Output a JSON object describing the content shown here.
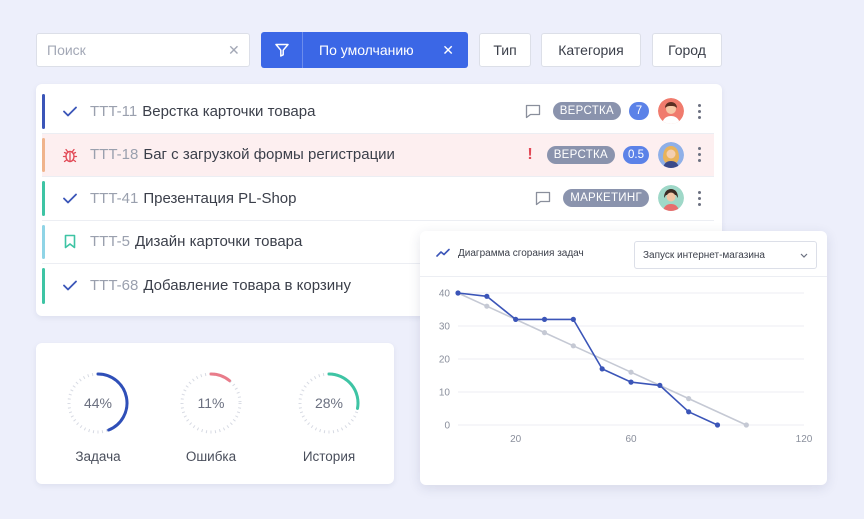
{
  "toolbar": {
    "search_placeholder": "Поиск",
    "filter_label": "По умолчанию",
    "chips": [
      "Тип",
      "Категория",
      "Город"
    ]
  },
  "tasks": [
    {
      "key": "TTT-11",
      "title": "Верстка карточки товара",
      "type": "check-icon",
      "accent": "#3b55b8",
      "tag": "ВЕРСТКА",
      "count": "7",
      "comment": true
    },
    {
      "key": "TTT-18",
      "title": "Баг с загрузкой формы регистрации",
      "type": "bug-icon",
      "accent": "#f0b48c",
      "tag": "ВЕРСТКА",
      "count": "0.5",
      "priority": "!"
    },
    {
      "key": "TTT-41",
      "title": "Презентация PL-Shop",
      "type": "check-icon",
      "accent": "#3ec4a4",
      "tag": "МАРКЕТИНГ",
      "comment": true
    },
    {
      "key": "TTT-5",
      "title": "Дизайн карточки товара",
      "type": "bookmark-icon",
      "accent": "#8fd4e6"
    },
    {
      "key": "TTT-68",
      "title": "Добавление товара в корзину",
      "type": "check-icon",
      "accent": "#3ec4a4"
    }
  ],
  "stats": [
    {
      "label": "Задача",
      "percent": "44%",
      "value": 0.44,
      "color": "#2f4fb8"
    },
    {
      "label": "Ошибка",
      "percent": "11%",
      "value": 0.11,
      "color": "#e97c8a"
    },
    {
      "label": "История",
      "percent": "28%",
      "value": 0.28,
      "color": "#3ec4a4"
    }
  ],
  "chart": {
    "title": "Диаграмма сгорания задач",
    "select_value": "Запуск интернет-магазина"
  },
  "chart_data": {
    "type": "line",
    "title": "Диаграмма сгорания задач",
    "xlim": [
      0,
      120
    ],
    "ylim": [
      0,
      40
    ],
    "x_ticks": [
      20,
      60,
      120
    ],
    "y_ticks": [
      0,
      10,
      20,
      30,
      40
    ],
    "series": [
      {
        "color": "#3b55b8",
        "points": [
          [
            0,
            40
          ],
          [
            10,
            39
          ],
          [
            20,
            32
          ],
          [
            30,
            32
          ],
          [
            40,
            32
          ],
          [
            50,
            17
          ],
          [
            60,
            13
          ],
          [
            70,
            12
          ],
          [
            80,
            4
          ],
          [
            90,
            0
          ]
        ]
      },
      {
        "color": "#c5c9d4",
        "points": [
          [
            0,
            40
          ],
          [
            10,
            36
          ],
          [
            30,
            28
          ],
          [
            40,
            24
          ],
          [
            60,
            16
          ],
          [
            80,
            8
          ],
          [
            100,
            0
          ]
        ]
      }
    ],
    "grid": true
  },
  "colors": {
    "primary": "#3b67e6",
    "tag_bg": "#8a93ad",
    "bug_row_bg": "#fdeff0"
  }
}
